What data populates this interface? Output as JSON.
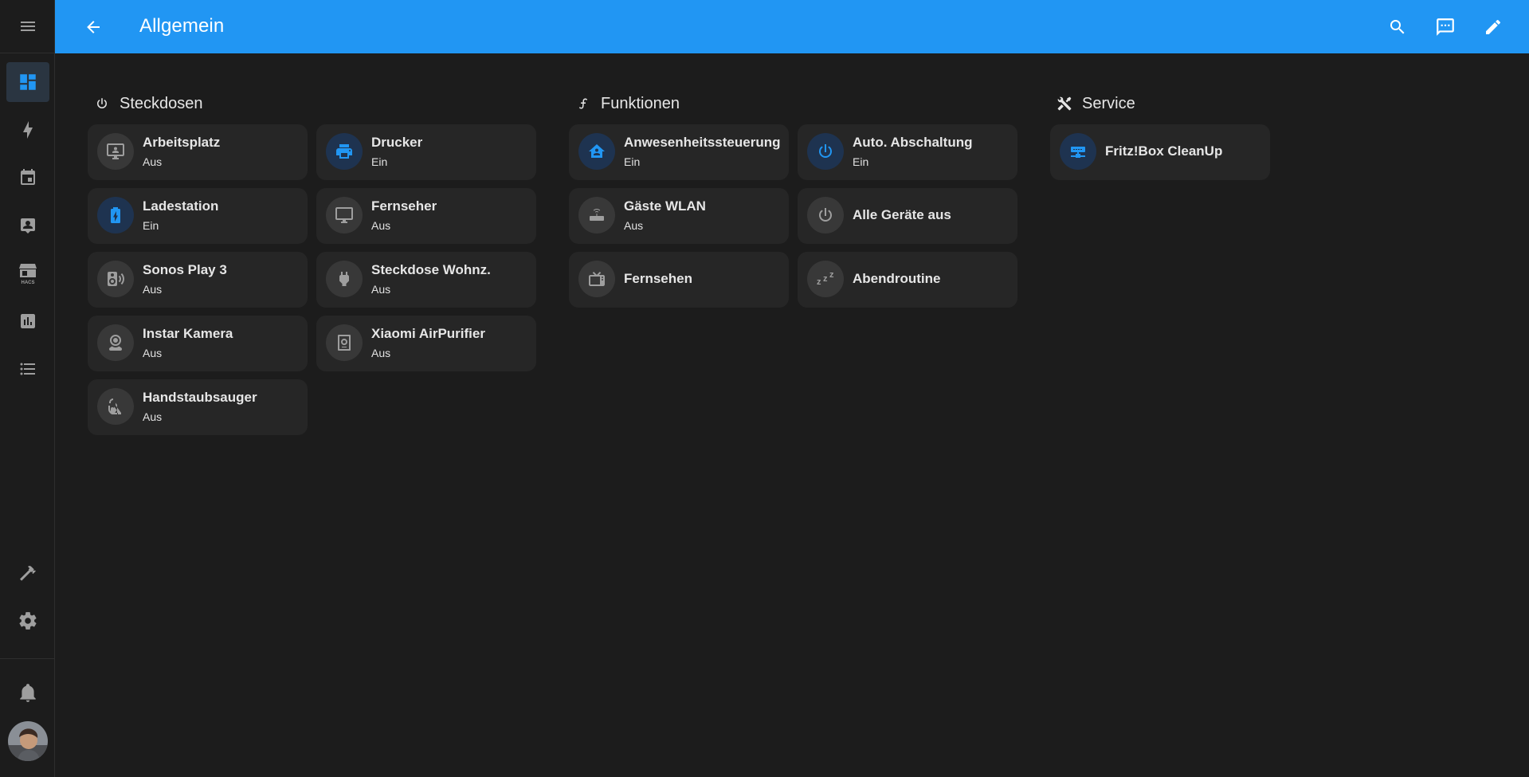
{
  "header": {
    "title": "Allgemein"
  },
  "sidebar": {
    "items": [
      {
        "name": "dashboard-icon",
        "active": true
      },
      {
        "name": "energy-icon"
      },
      {
        "name": "calendar-icon"
      },
      {
        "name": "person-card-icon"
      },
      {
        "name": "hacs-icon",
        "label": "HACS"
      },
      {
        "name": "chart-icon"
      },
      {
        "name": "list-icon"
      },
      {
        "name": "hammer-icon"
      },
      {
        "name": "gear-icon"
      },
      {
        "name": "bell-icon"
      }
    ]
  },
  "colors": {
    "accent": "#2196f3",
    "background": "#1c1c1c",
    "tile": "#262626",
    "icon_on": "#2196f3",
    "icon_off": "#9e9e9e"
  },
  "sections": [
    {
      "title": "Steckdosen",
      "icon": "power-icon",
      "tiles": [
        {
          "name": "Arbeitsplatz",
          "state": "Aus",
          "icon": "monitor-account-icon",
          "on": false
        },
        {
          "name": "Drucker",
          "state": "Ein",
          "icon": "printer-icon",
          "on": true
        },
        {
          "name": "Ladestation",
          "state": "Ein",
          "icon": "battery-charging-icon",
          "on": true
        },
        {
          "name": "Fernseher",
          "state": "Aus",
          "icon": "monitor-icon",
          "on": false
        },
        {
          "name": "Sonos Play 3",
          "state": "Aus",
          "icon": "speaker-wireless-icon",
          "on": false
        },
        {
          "name": "Steckdose Wohnz.",
          "state": "Aus",
          "icon": "power-plug-icon",
          "on": false
        },
        {
          "name": "Instar Kamera",
          "state": "Aus",
          "icon": "webcam-icon",
          "on": false
        },
        {
          "name": "Xiaomi AirPurifier",
          "state": "Aus",
          "icon": "air-purifier-icon",
          "on": false
        },
        {
          "name": "Handstaubsauger",
          "state": "Aus",
          "icon": "vacuum-icon",
          "on": false
        }
      ]
    },
    {
      "title": "Funktionen",
      "icon": "function-icon",
      "tiles": [
        {
          "name": "Anwesenheitssteuerung",
          "state": "Ein",
          "icon": "home-account-icon",
          "on": true
        },
        {
          "name": "Auto. Abschaltung",
          "state": "Ein",
          "icon": "power-icon",
          "on": true
        },
        {
          "name": "Gäste WLAN",
          "state": "Aus",
          "icon": "router-wireless-icon",
          "on": false
        },
        {
          "name": "Alle Geräte aus",
          "state": "",
          "icon": "power-icon",
          "on": false
        },
        {
          "name": "Fernsehen",
          "state": "",
          "icon": "television-classic-icon",
          "on": false
        },
        {
          "name": "Abendroutine",
          "state": "",
          "icon": "sleep-icon",
          "on": false
        }
      ]
    },
    {
      "title": "Service",
      "icon": "tools-icon",
      "tiles": [
        {
          "name": "Fritz!Box CleanUp",
          "state": "",
          "icon": "lan-icon",
          "on": true
        }
      ]
    }
  ]
}
